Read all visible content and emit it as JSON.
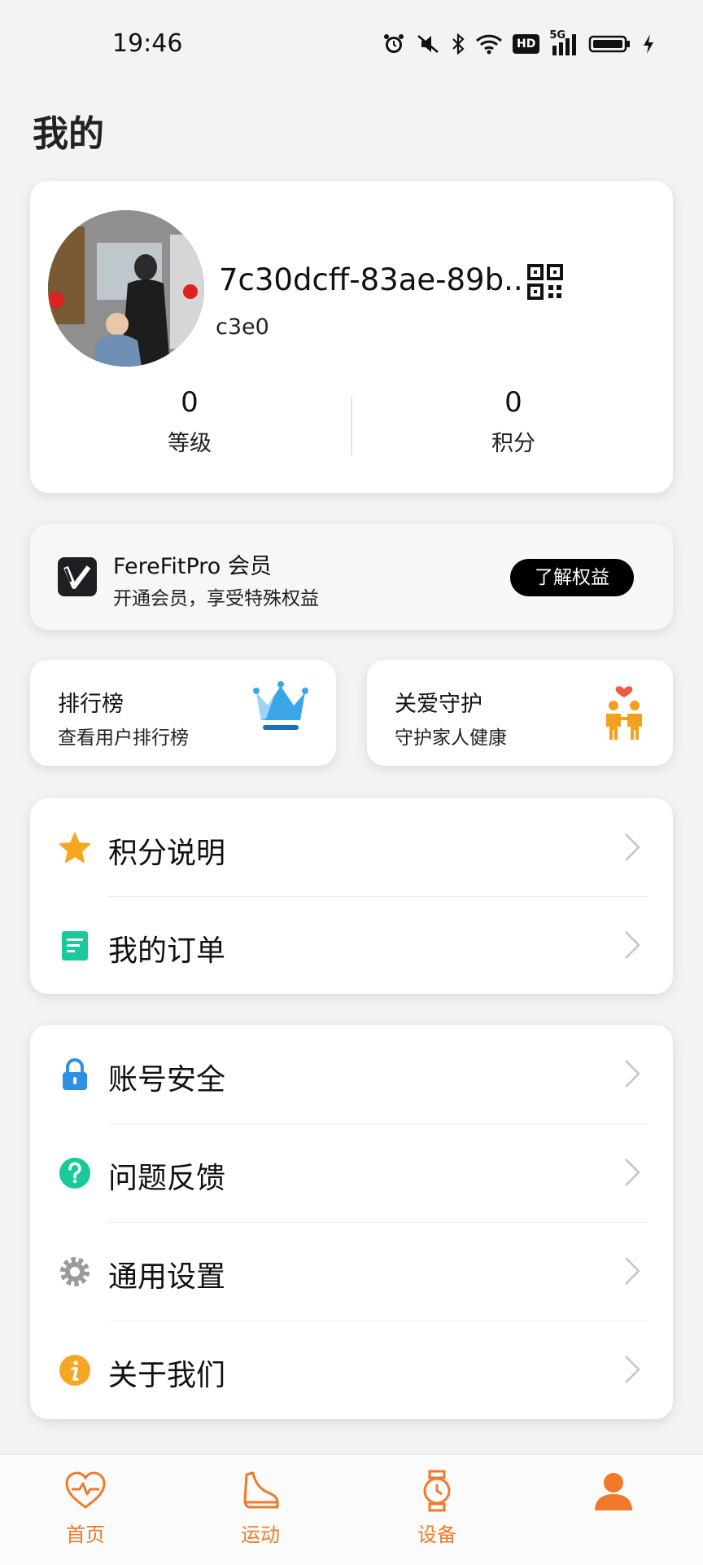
{
  "status_bar": {
    "time": "19:46",
    "hd_label": "HD",
    "network_label": "5G"
  },
  "page": {
    "title": "我的"
  },
  "profile": {
    "username_line1": "7c30dcff-83ae-89b...",
    "username_line2": "c3e0",
    "stats": [
      {
        "value": "0",
        "label": "等级"
      },
      {
        "value": "0",
        "label": "积分"
      }
    ]
  },
  "membership": {
    "title": "FereFitPro 会员",
    "subtitle": "开通会员，享受特殊权益",
    "button_label": "了解权益"
  },
  "quick_cards": [
    {
      "title": "排行榜",
      "subtitle": "查看用户排行榜",
      "icon": "crown-icon"
    },
    {
      "title": "关爱守护",
      "subtitle": "守护家人健康",
      "icon": "family-icon"
    }
  ],
  "menu_group_1": [
    {
      "label": "积分说明",
      "icon": "star-icon"
    },
    {
      "label": "我的订单",
      "icon": "order-icon"
    }
  ],
  "menu_group_2": [
    {
      "label": "账号安全",
      "icon": "lock-icon"
    },
    {
      "label": "问题反馈",
      "icon": "question-icon"
    },
    {
      "label": "通用设置",
      "icon": "gear-icon"
    },
    {
      "label": "关于我们",
      "icon": "info-icon"
    }
  ],
  "tab_bar": [
    {
      "label": "首页",
      "icon": "heart-pulse-icon"
    },
    {
      "label": "运动",
      "icon": "shoe-icon"
    },
    {
      "label": "设备",
      "icon": "watch-icon"
    },
    {
      "label": "",
      "icon": "person-icon"
    }
  ],
  "colors": {
    "accent": "#f07a2a",
    "background": "#f3f3f3",
    "vip_button": "#000000"
  }
}
